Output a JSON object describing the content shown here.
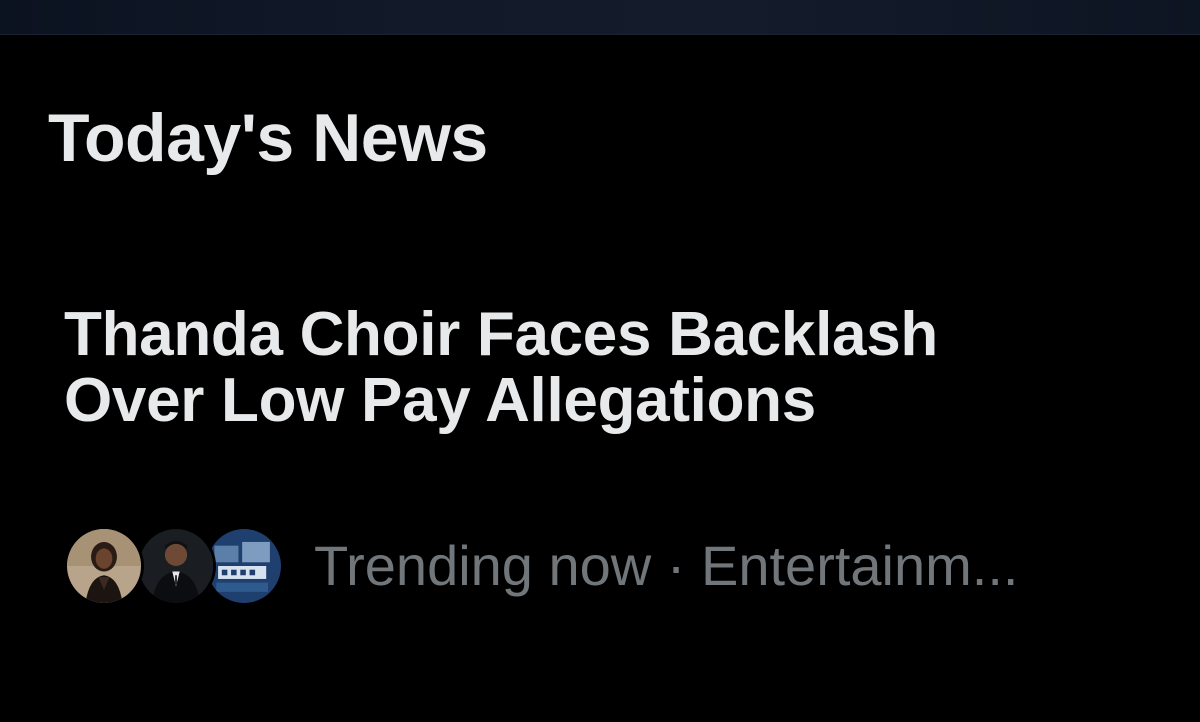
{
  "section": {
    "title": "Today's News"
  },
  "story": {
    "headline_line1": "Thanda Choir Faces Backlash",
    "headline_line2": "Over Low Pay Allegations",
    "meta": "Trending now · Entertainm..."
  },
  "avatars": [
    {
      "name": "avatar-woman-photo"
    },
    {
      "name": "avatar-man-suit-photo"
    },
    {
      "name": "avatar-news-logo"
    }
  ],
  "colors": {
    "background": "#000000",
    "primary_text": "#e7e9ea",
    "secondary_text": "#71767b"
  }
}
